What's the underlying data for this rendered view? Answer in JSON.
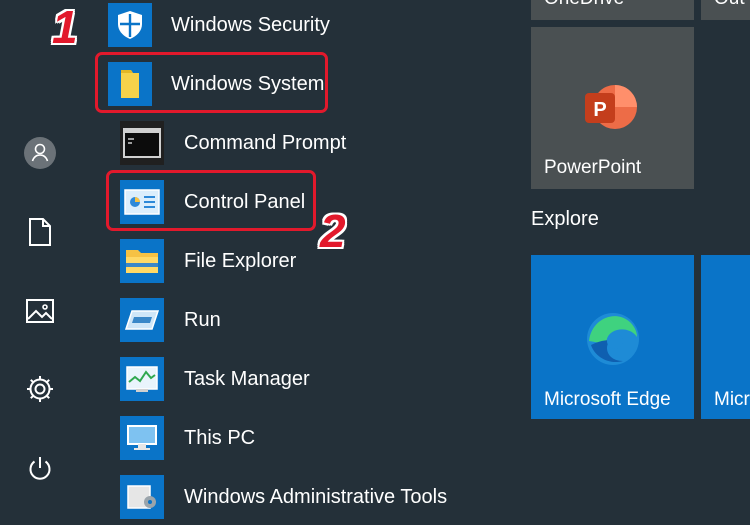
{
  "start_list": {
    "security": {
      "label": "Windows Security",
      "icon": "shield-icon"
    },
    "system_folder": {
      "label": "Windows System",
      "icon": "folder-icon",
      "expanded": true,
      "toggle_icon": "chevron-up-icon"
    },
    "items": [
      {
        "label": "Command Prompt",
        "icon": "command-prompt-icon"
      },
      {
        "label": "Control Panel",
        "icon": "control-panel-icon"
      },
      {
        "label": "File Explorer",
        "icon": "file-explorer-icon"
      },
      {
        "label": "Run",
        "icon": "run-icon"
      },
      {
        "label": "Task Manager",
        "icon": "task-manager-icon"
      },
      {
        "label": "This PC",
        "icon": "this-pc-icon"
      },
      {
        "label": "Windows Administrative Tools",
        "icon": "admin-tools-icon"
      }
    ]
  },
  "rail": {
    "icons": [
      "user-avatar-icon",
      "document-icon",
      "pictures-icon",
      "settings-gear-icon",
      "power-icon"
    ]
  },
  "tiles": {
    "top_partial": {
      "label_1": "OneDrive",
      "label_2": "Out"
    },
    "powerpoint": {
      "label": "PowerPoint",
      "icon": "powerpoint-icon",
      "glyph": "P"
    },
    "group_explore": "Explore",
    "edge": {
      "label": "Microsoft Edge",
      "icon": "edge-icon"
    },
    "partial_tile": {
      "label": "Micr"
    }
  },
  "annotations": {
    "step_1": "1",
    "step_2": "2"
  },
  "colors": {
    "background": "#243039",
    "tile_blue": "#0a74c8",
    "tile_gray": "#4a5052",
    "highlight_red": "#e2192c",
    "powerpoint_orange": "#d24726",
    "folder_yellow": "#f6d24a"
  }
}
